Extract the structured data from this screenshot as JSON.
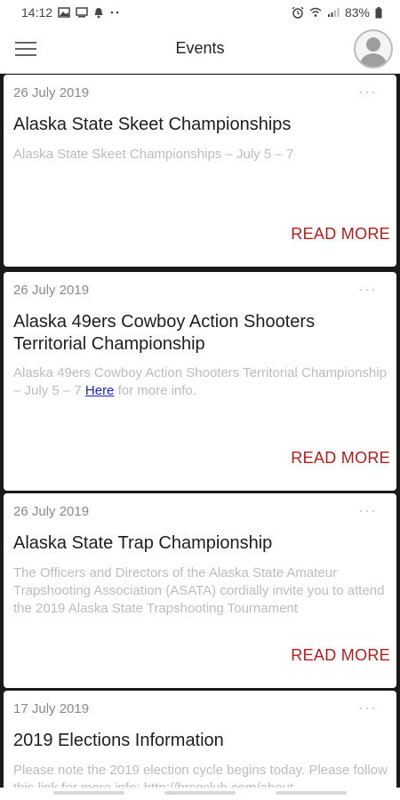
{
  "status_bar": {
    "time": "14:12",
    "battery": "83%",
    "icons_left": [
      "image-icon",
      "monitor-icon",
      "bell-off-icon",
      "more-dots-icon"
    ],
    "icons_right": [
      "alarm-icon",
      "wifi-icon",
      "signal-icon",
      "battery-icon"
    ]
  },
  "app_bar": {
    "title": "Events",
    "menu_icon": "hamburger-menu-icon",
    "avatar_icon": "user-avatar-icon"
  },
  "events": [
    {
      "date": "26 July 2019",
      "more": "···",
      "title": "Alaska State Skeet Championships",
      "excerpt": "Alaska State Skeet Championships  – July 5 – 7",
      "read_more": "READ MORE"
    },
    {
      "date": "26 July 2019",
      "more": "···",
      "title": "Alaska 49ers Cowboy Action Shooters Territorial Championship",
      "excerpt_before": "Alaska 49ers Cowboy Action Shooters Territorial Championship – July 5 – 7 ",
      "excerpt_link": "Here",
      "excerpt_after": " for more info.",
      "read_more": "READ MORE"
    },
    {
      "date": "26 July 2019",
      "more": "···",
      "title": "Alaska State Trap Championship",
      "excerpt": "The Officers and Directors of the Alaska State Amateur Trapshooting Association (ASATA) cordially invite you to attend the 2019 Alaska State Trapshooting Tournament",
      "read_more": "READ MORE"
    },
    {
      "date": "17 July 2019",
      "more": "···",
      "title": "2019 Elections Information",
      "excerpt": "Please note the 2019 election cycle begins today. Please follow this link for more info: http://brcgclub.com/about"
    }
  ],
  "colors": {
    "accent_read_more": "#b71c1c",
    "link": "#1a26c9",
    "background": "#1a1a1a",
    "card": "#ffffff"
  }
}
